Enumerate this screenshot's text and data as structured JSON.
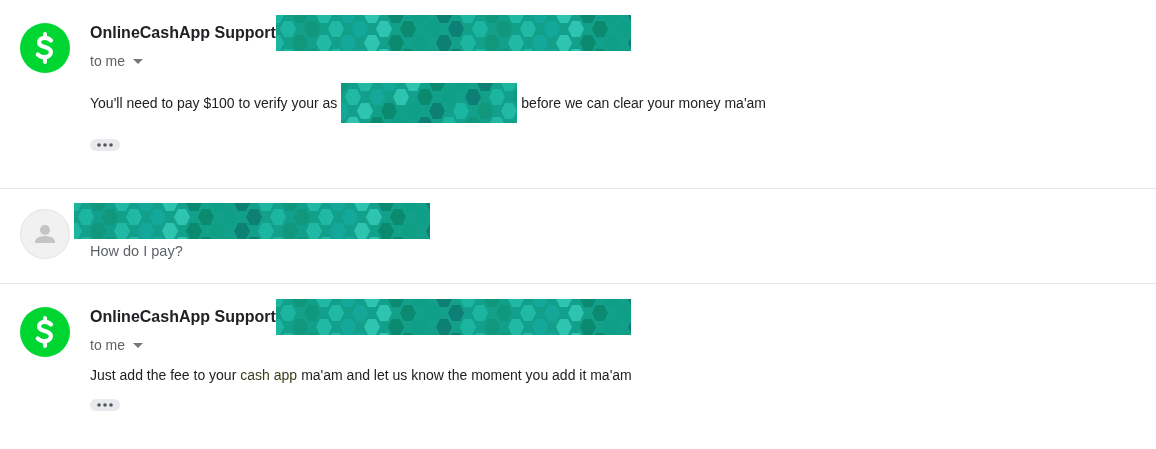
{
  "messages": [
    {
      "kind": "cash",
      "expanded": true,
      "sender": "OnlineCashApp Support",
      "recipient": "to me",
      "body": [
        {
          "kind": "text",
          "text": "You'll need to pay $100 to verify your as"
        },
        {
          "kind": "redaction"
        },
        {
          "kind": "text",
          "text": "before we can clear your money ma'am"
        }
      ]
    },
    {
      "kind": "person",
      "expanded": false,
      "snippet": "How do I pay?"
    },
    {
      "kind": "cash",
      "expanded": true,
      "sender": "OnlineCashApp Support",
      "recipient": "to me",
      "body": [
        {
          "kind": "text",
          "text": "Just add the fee to your"
        },
        {
          "kind": "highlight",
          "text": "cash app"
        },
        {
          "kind": "text",
          "text": "ma'am and let us know the moment you add it ma'am"
        }
      ]
    }
  ]
}
